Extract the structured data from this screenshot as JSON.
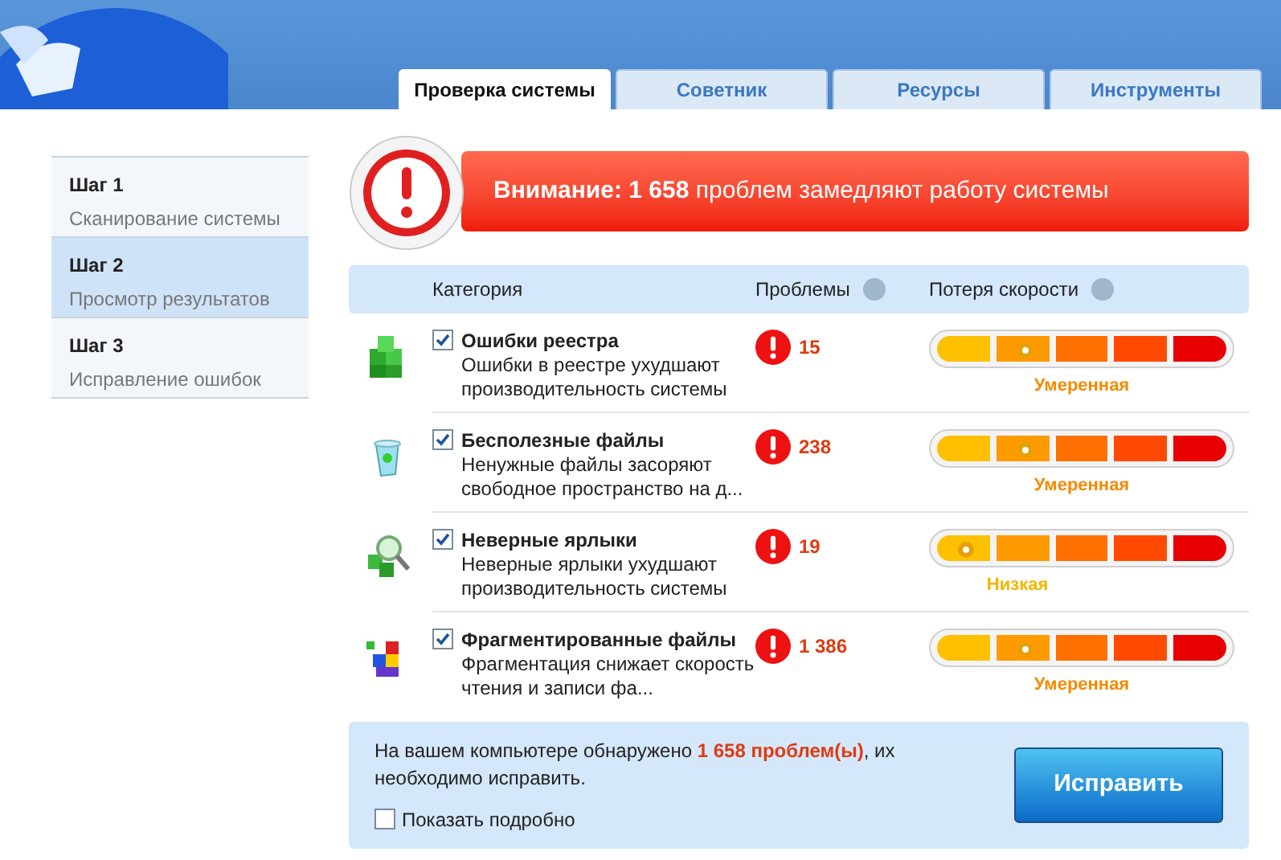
{
  "tabs": [
    {
      "label": "Проверка системы",
      "selected": true
    },
    {
      "label": "Советник",
      "selected": false
    },
    {
      "label": "Ресурсы",
      "selected": false
    },
    {
      "label": "Инструменты",
      "selected": false
    }
  ],
  "steps": [
    {
      "title": "Шаг 1",
      "subtitle": "Сканирование системы",
      "selected": false
    },
    {
      "title": "Шаг 2",
      "subtitle": "Просмотр результатов",
      "selected": true
    },
    {
      "title": "Шаг 3",
      "subtitle": "Исправление ошибок",
      "selected": false
    }
  ],
  "alert": "**Внимание: 1 658** проблем замедляют работу системы",
  "table": {
    "columns": [
      "Категория",
      "Проблемы",
      "Потеря скорости"
    ],
    "rows": [
      {
        "kind": "registry",
        "title": "Ошибки реестра",
        "description": "Ошибки в реестре ухудшают производительность системы",
        "checked": true,
        "count": "15",
        "level": 0.3,
        "rating": "Умеренная"
      },
      {
        "kind": "junk",
        "title": "Бесполезные файлы",
        "description": "Ненужные файлы засоряют свободное пространство на д...",
        "checked": true,
        "count": "238",
        "level": 0.3,
        "rating": "Умеренная"
      },
      {
        "kind": "shortcuts",
        "title": "Неверные ярлыки",
        "description": "Неверные ярлыки ухудшают производительность системы",
        "checked": true,
        "count": "19",
        "level": 0.1,
        "rating": "Низкая"
      },
      {
        "kind": "fragment",
        "title": "Фрагментированные файлы",
        "description": "Фрагментация снижает скорость чтения и записи фа...",
        "checked": true,
        "count": "1 386",
        "level": 0.3,
        "rating": "Умеренная"
      }
    ]
  },
  "summary": {
    "text_before": "На вашем компьютере обнаружено",
    "highlight": "1 658 проблем(ы)",
    "text_after": ", их необходимо исправить.",
    "details_label": "Показать подробно",
    "details_checked": false,
    "fix_button": "Исправить"
  }
}
